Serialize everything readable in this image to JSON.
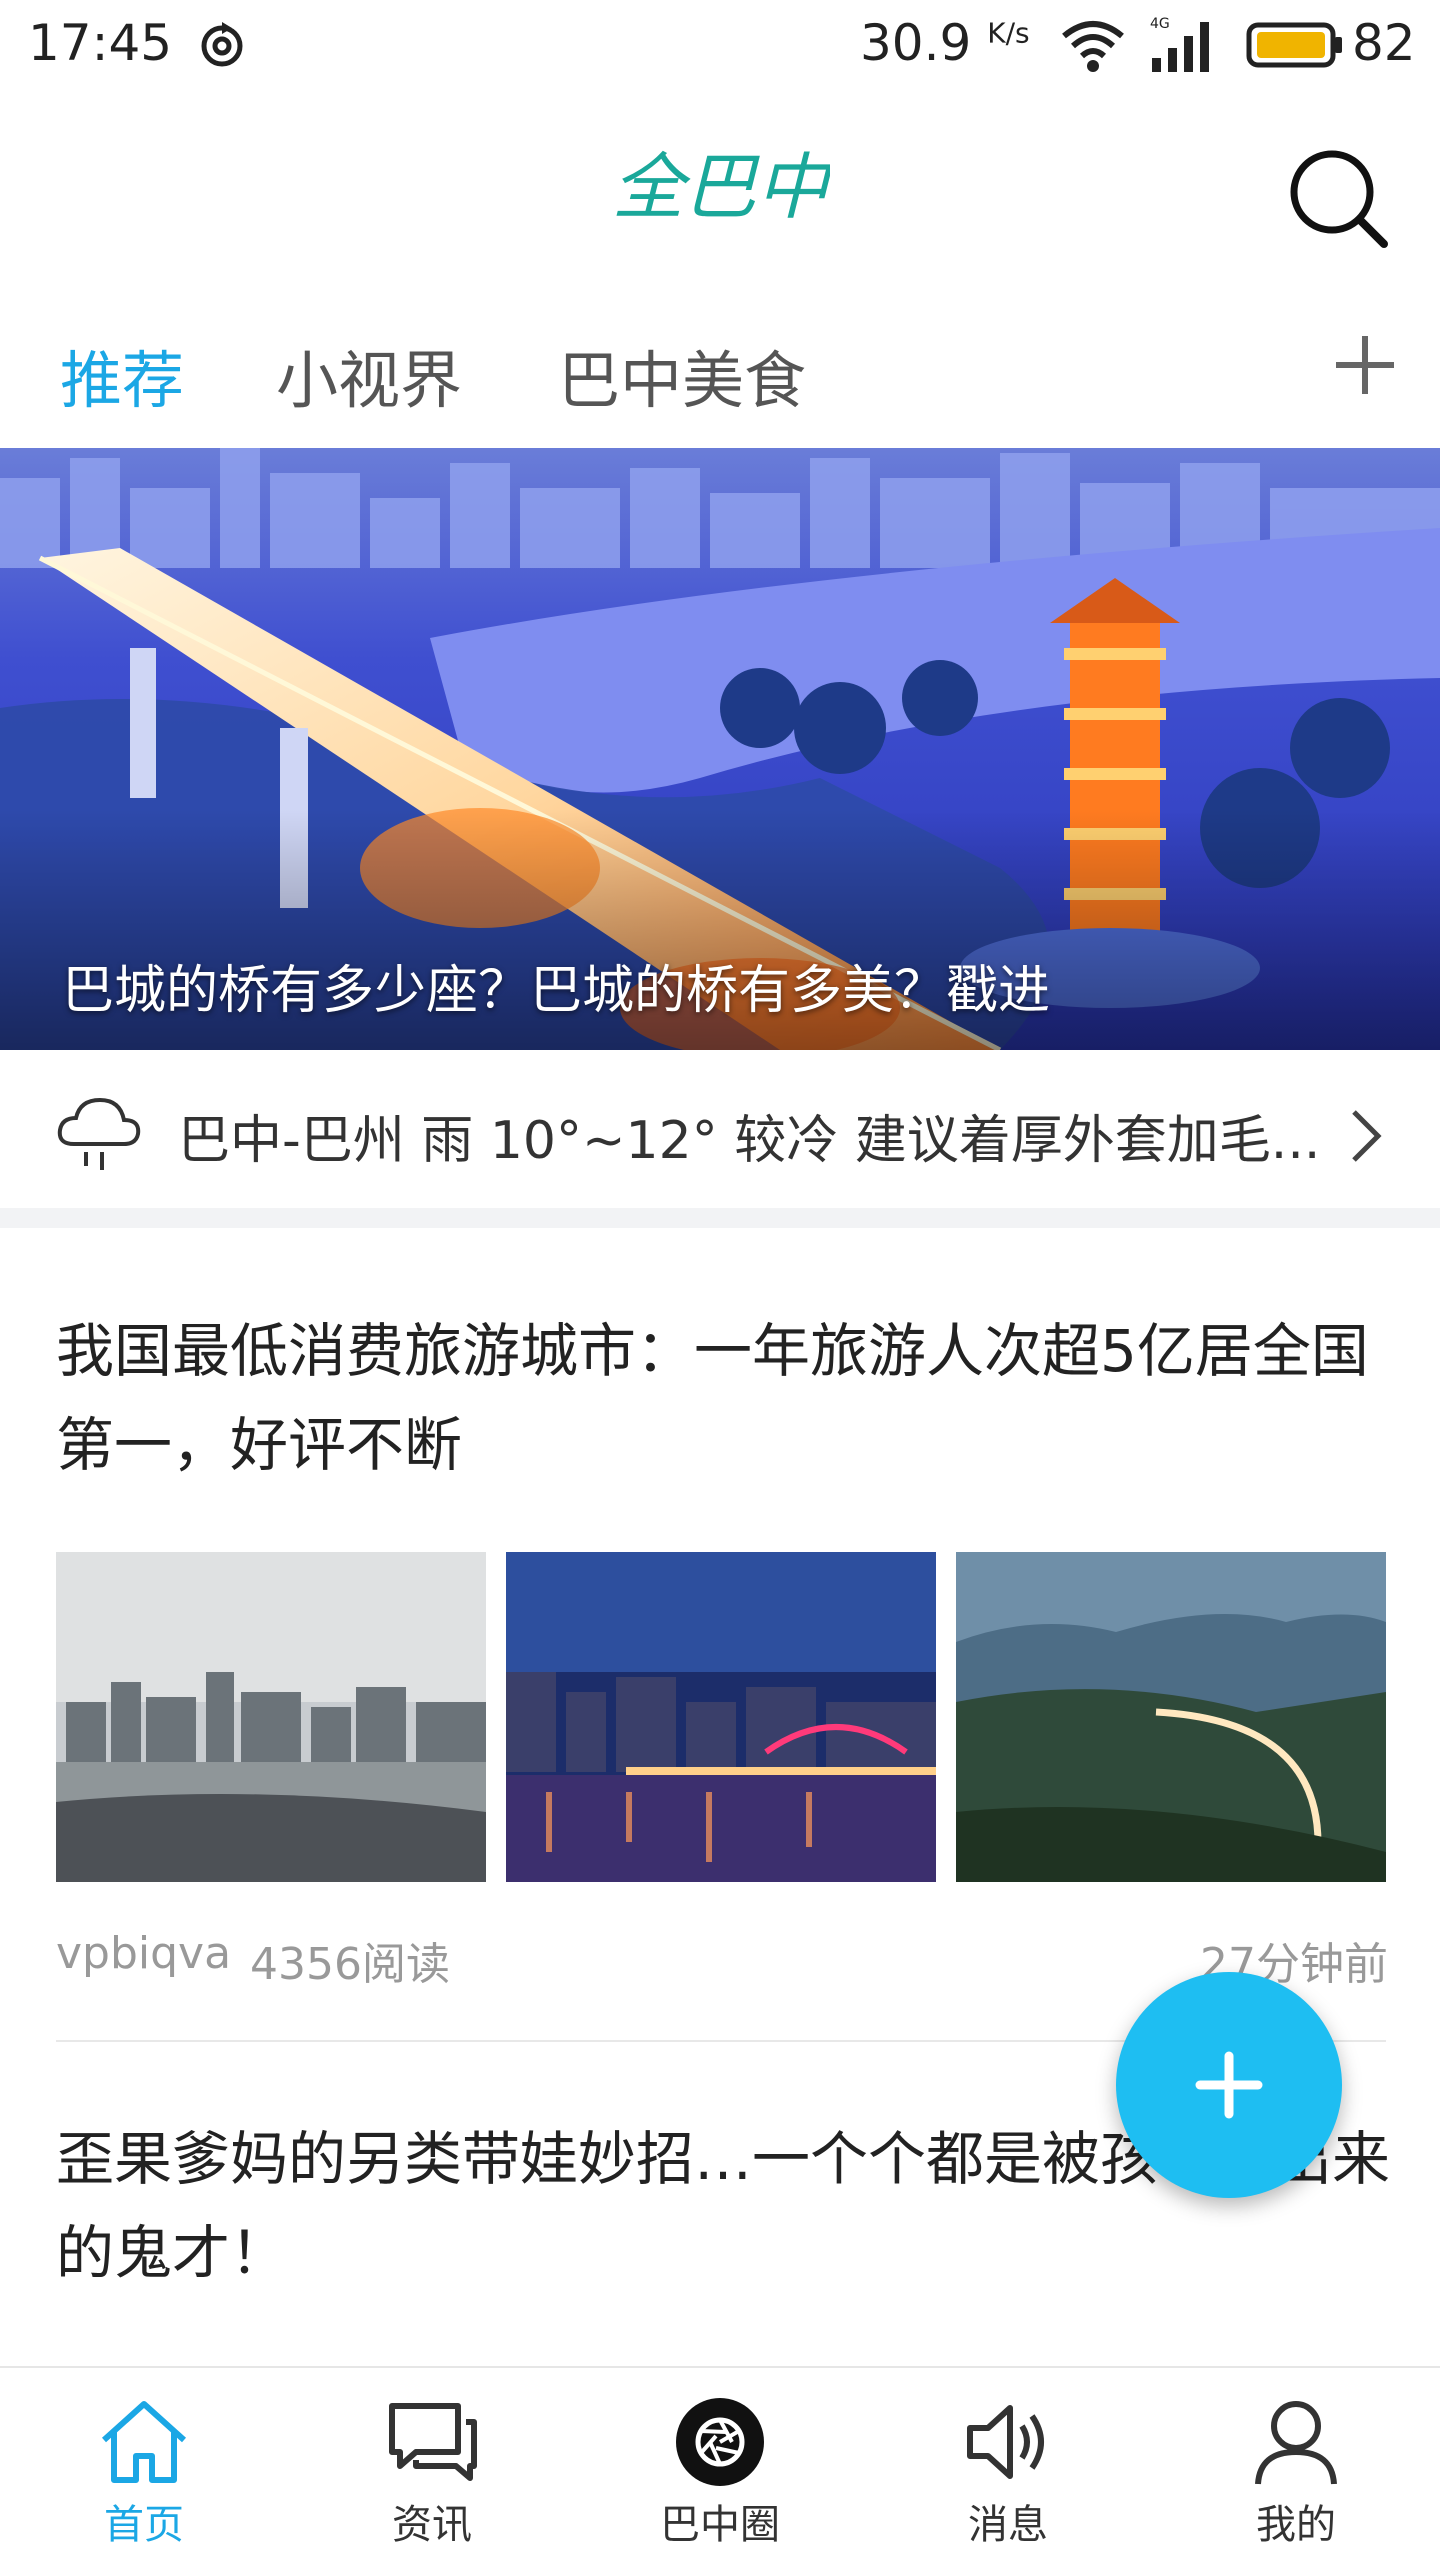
{
  "status_bar": {
    "time": "17:45",
    "network_speed": "30.9",
    "speed_unit": "K/s",
    "network_type": "4G",
    "battery": "82",
    "icons": [
      "sync-icon",
      "wifi-icon",
      "signal-icon",
      "battery-icon"
    ]
  },
  "header": {
    "logo_text": "全巴中",
    "search_icon": "search-icon"
  },
  "tabs": [
    {
      "label": "推荐",
      "active": true
    },
    {
      "label": "小视界",
      "active": false
    },
    {
      "label": "巴中美食",
      "active": false
    }
  ],
  "banner": {
    "caption": "巴城的桥有多少座？巴城的桥有多美？戳进"
  },
  "weather": {
    "text": "巴中-巴州 雨 10°~12° 较冷 建议着厚外套加毛...",
    "icon": "rain-cloud-icon"
  },
  "articles": [
    {
      "title": "我国最低消费旅游城市：一年旅游人次超5亿居全国第一，好评不断",
      "author": "vpbiqva",
      "reads": "4356阅读",
      "time": "27分钟前"
    },
    {
      "title": "歪果爹妈的另类带娃妙招…一个个都是被孩子逼出来的鬼才！"
    }
  ],
  "bottom_nav": [
    {
      "label": "首页",
      "icon": "home-icon",
      "active": true
    },
    {
      "label": "资讯",
      "icon": "chat-icon",
      "active": false
    },
    {
      "label": "巴中圈",
      "icon": "camera-aperture-icon",
      "active": false
    },
    {
      "label": "消息",
      "icon": "speaker-icon",
      "active": false
    },
    {
      "label": "我的",
      "icon": "user-icon",
      "active": false
    }
  ],
  "colors": {
    "accent": "#1ba7e5",
    "fab": "#1ebef2",
    "logo": "#1aa89a"
  }
}
